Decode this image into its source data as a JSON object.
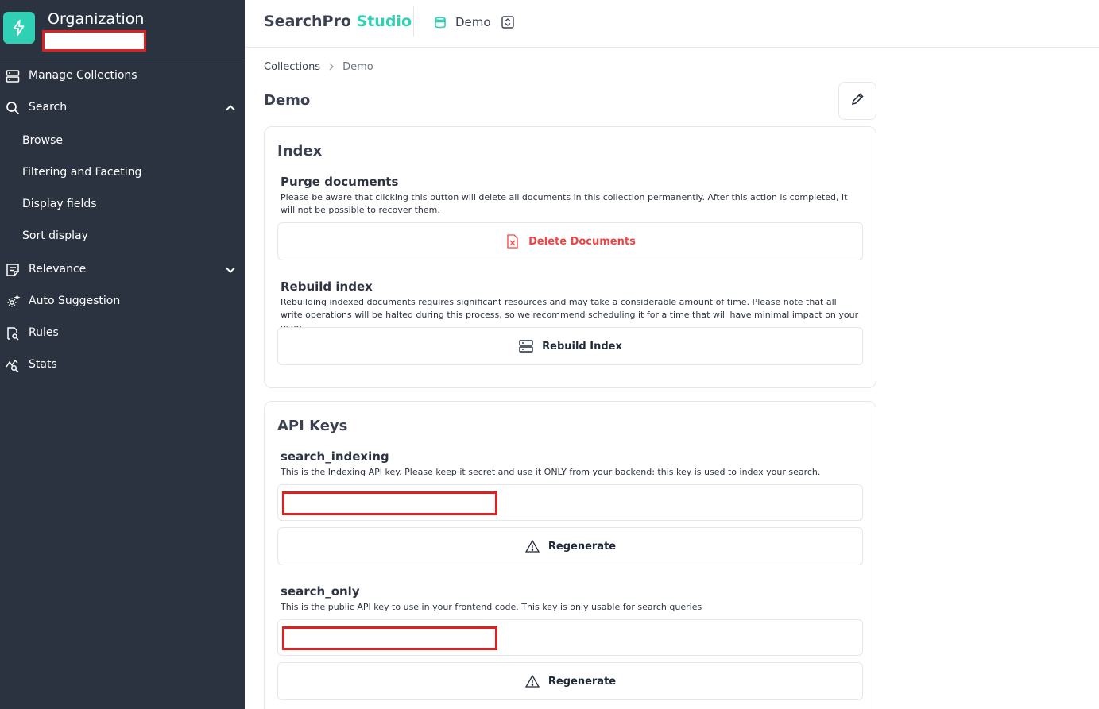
{
  "sidebar": {
    "org_title": "Organization",
    "items": [
      {
        "label": "Manage Collections",
        "icon": "server-icon"
      },
      {
        "label": "Search",
        "icon": "search-icon",
        "expanded": true
      },
      {
        "label": "Relevance",
        "icon": "relevance-icon",
        "expanded": false
      },
      {
        "label": "Auto Suggestion",
        "icon": "auto-suggestion-icon"
      },
      {
        "label": "Rules",
        "icon": "rules-icon"
      },
      {
        "label": "Stats",
        "icon": "stats-icon"
      }
    ],
    "search_subitems": [
      "Browse",
      "Filtering and Faceting",
      "Display fields",
      "Sort display"
    ]
  },
  "header": {
    "brand_main": "SearchPro",
    "brand_accent": "Studio",
    "collection_name": "Demo"
  },
  "breadcrumb": {
    "root": "Collections",
    "current": "Demo"
  },
  "page": {
    "title": "Demo"
  },
  "index_card": {
    "title": "Index",
    "purge": {
      "title": "Purge documents",
      "description": "Please be aware that clicking this button will delete all documents in this collection permanently. After this action is completed, it will not be possible to recover them.",
      "button": "Delete Documents"
    },
    "rebuild": {
      "title": "Rebuild index",
      "description": "Rebuilding indexed documents requires significant resources and may take a considerable amount of time. Please note that all write operations will be halted during this process, so we recommend scheduling it for a time that will have minimal impact on your users.",
      "button": "Rebuild Index"
    }
  },
  "api_card": {
    "title": "API Keys",
    "keys": [
      {
        "name": "search_indexing",
        "description": "This is the Indexing API key. Please keep it secret and use it ONLY from your backend: this key is used to index your search.",
        "button": "Regenerate"
      },
      {
        "name": "search_only",
        "description": "This is the public API key to use in your frontend code. This key is only usable for search queries",
        "button": "Regenerate"
      }
    ]
  },
  "colors": {
    "sidebar_bg": "#2c3340",
    "accent": "#2fd0b3",
    "danger": "#ef4444",
    "redaction": "#e02020"
  }
}
